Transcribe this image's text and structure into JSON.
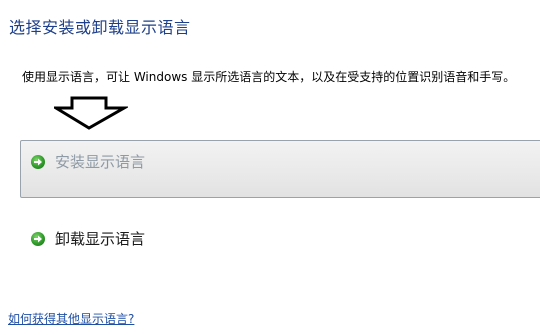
{
  "title": "选择安装或卸载显示语言",
  "description": "使用显示语言，可让 Windows 显示所选语言的文本，以及在受支持的位置识别语音和手写。",
  "options": {
    "install": {
      "label": "安装显示语言",
      "icon": "green-arrow-icon"
    },
    "uninstall": {
      "label": "卸载显示语言",
      "icon": "green-arrow-icon"
    }
  },
  "annotation": {
    "icon": "down-arrow-outline-icon"
  },
  "help_link": "如何获得其他显示语言?",
  "colors": {
    "title": "#1e3f8a",
    "link": "#1f4fa5",
    "icon_green": "#2f9a2a",
    "install_text": "#8e9aa6"
  }
}
